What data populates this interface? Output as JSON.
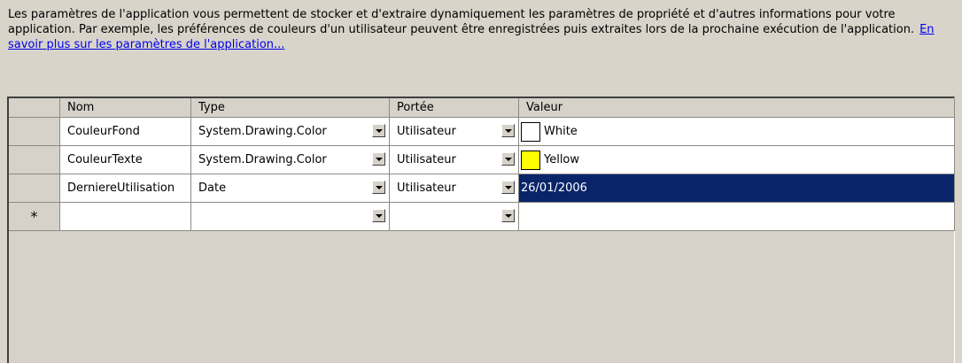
{
  "description": {
    "text": "Les paramètres de l'application vous permettent de stocker et d'extraire dynamiquement les paramètres de propriété et d'autres informations pour votre application. Par exemple, les préférences de couleurs d'un utilisateur peuvent être enregistrées puis extraites lors de la prochaine exécution de l'application.",
    "link": "En savoir plus sur les paramètres de l'application..."
  },
  "grid": {
    "columns": [
      "Nom",
      "Type",
      "Portée",
      "Valeur"
    ],
    "rows": [
      {
        "nom": "CouleurFond",
        "type": "System.Drawing.Color",
        "portee": "Utilisateur",
        "valeur": "White",
        "swatch": "#ffffff"
      },
      {
        "nom": "CouleurTexte",
        "type": "System.Drawing.Color",
        "portee": "Utilisateur",
        "valeur": "Yellow",
        "swatch": "#ffff00"
      },
      {
        "nom": "DerniereUtilisation",
        "type": "Date",
        "portee": "Utilisateur",
        "valeur": "26/01/2006"
      }
    ],
    "new_row_marker": "*"
  },
  "colors": {
    "selection": "#0a246a",
    "background": "#d8d4ca"
  }
}
